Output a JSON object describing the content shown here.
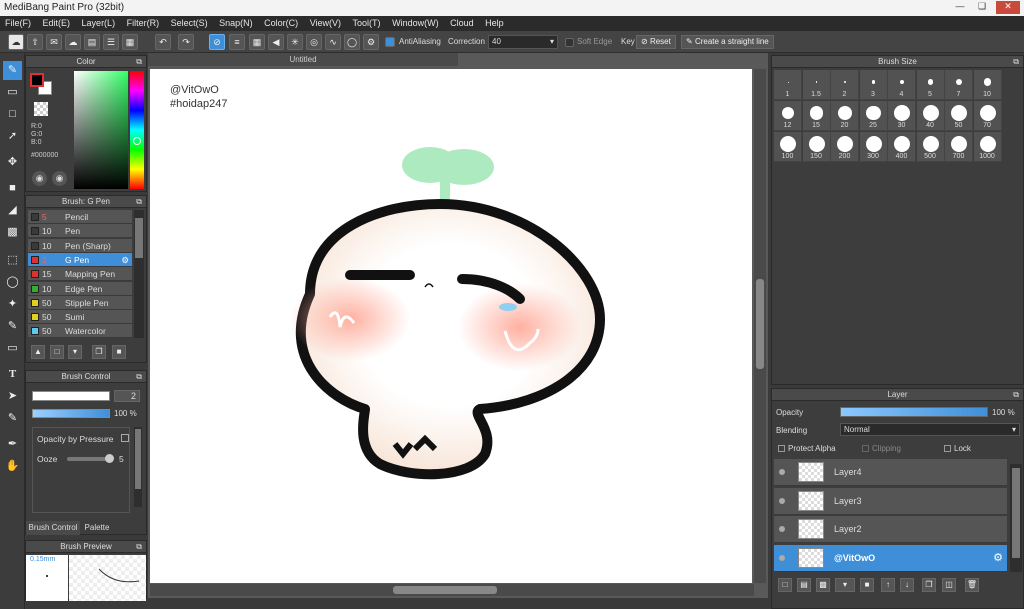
{
  "window": {
    "title": "MediBang Paint Pro (32bit)"
  },
  "menu": [
    "File(F)",
    "Edit(E)",
    "Layer(L)",
    "Filter(R)",
    "Select(S)",
    "Snap(N)",
    "Color(C)",
    "View(V)",
    "Tool(T)",
    "Window(W)",
    "Cloud",
    "Help"
  ],
  "toolbar": {
    "antialiasing_label": "AntiAliasing",
    "correction_label": "Correction",
    "correction_value": "40",
    "soft_edge_label": "Soft Edge",
    "key_label": "Key",
    "reset_label": "Reset",
    "straight_line_label": "Create a straight line"
  },
  "color_panel": {
    "title": "Color",
    "r": "R:0",
    "g": "G:0",
    "b": "B:0",
    "hex": "#000000",
    "colors": {
      "foreground": "#000000",
      "background": "#ffffff",
      "accent": "#3f8fd8"
    }
  },
  "brush_panel": {
    "title": "Brush: G Pen",
    "items": [
      {
        "size": "5",
        "name": "Pencil",
        "color": "#3a3a3a",
        "size_color": "#ff6060"
      },
      {
        "size": "10",
        "name": "Pen",
        "color": "#3a3a3a",
        "size_color": ""
      },
      {
        "size": "10",
        "name": "Pen (Sharp)",
        "color": "#3a3a3a",
        "size_color": ""
      },
      {
        "size": "2",
        "name": "G Pen",
        "color": "#e03030",
        "size_color": "#ff6060",
        "selected": true
      },
      {
        "size": "15",
        "name": "Mapping Pen",
        "color": "#e03030",
        "size_color": ""
      },
      {
        "size": "10",
        "name": "Edge Pen",
        "color": "#30b030",
        "size_color": ""
      },
      {
        "size": "50",
        "name": "Stipple Pen",
        "color": "#e0d020",
        "size_color": ""
      },
      {
        "size": "50",
        "name": "Sumi",
        "color": "#e0d020",
        "size_color": ""
      },
      {
        "size": "50",
        "name": "Watercolor",
        "color": "#60c8f0",
        "size_color": ""
      }
    ]
  },
  "brush_control": {
    "title": "Brush Control",
    "size_value": "2",
    "opacity_value": "100 %",
    "opacity_by_pressure_label": "Opacity by Pressure",
    "ooze_label": "Ooze",
    "ooze_value": "5",
    "tabs": [
      "Brush Control",
      "Palette"
    ]
  },
  "brush_preview": {
    "title": "Brush Preview",
    "size_text": "0.15mm"
  },
  "canvas": {
    "tab_title": "Untitled",
    "text_line1": "@VitOwO",
    "text_line2": "#hoidap247"
  },
  "brush_size_panel": {
    "title": "Brush Size",
    "sizes": [
      "1",
      "1.5",
      "2",
      "3",
      "4",
      "5",
      "7",
      "10",
      "12",
      "15",
      "20",
      "25",
      "30",
      "40",
      "50",
      "70",
      "100",
      "150",
      "200",
      "300",
      "400",
      "500",
      "700",
      "1000"
    ]
  },
  "layer_panel": {
    "title": "Layer",
    "opacity_label": "Opacity",
    "opacity_value": "100 %",
    "opacity_fraction": 1.0,
    "blending_label": "Blending",
    "blending_value": "Normal",
    "protect_alpha_label": "Protect Alpha",
    "clipping_label": "Clipping",
    "lock_label": "Lock",
    "layers": [
      {
        "name": "Layer4"
      },
      {
        "name": "Layer3"
      },
      {
        "name": "Layer2"
      },
      {
        "name": "@VitOwO",
        "selected": true
      }
    ]
  }
}
